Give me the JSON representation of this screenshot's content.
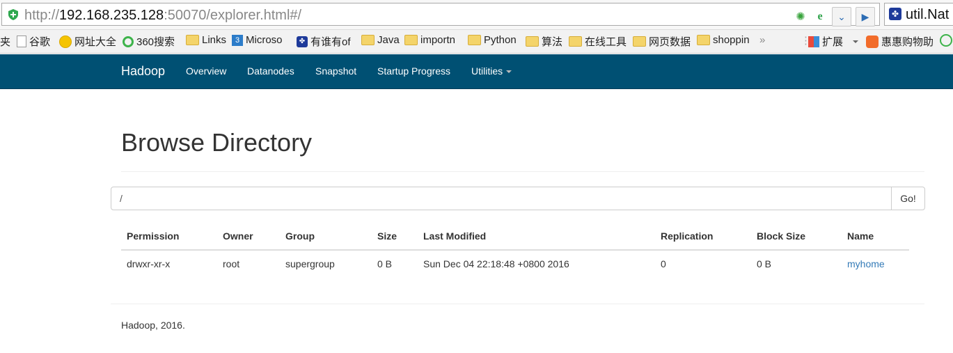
{
  "browser": {
    "url_prefix": "http://",
    "url_host": "192.168.235.128",
    "url_rest": ":50070/explorer.html#/",
    "side_text": "util.Nat",
    "colors": {
      "shield": "#2fa84f"
    }
  },
  "bookmarks": [
    {
      "label": "夹",
      "icon": "none"
    },
    {
      "label": "谷歌",
      "icon": "page-icon"
    },
    {
      "label": "网址大全",
      "icon": "plus-circle-icon"
    },
    {
      "label": "360搜索",
      "icon": "360-icon"
    },
    {
      "label": "Links",
      "icon": "folder-icon"
    },
    {
      "label": "Microso",
      "icon": "app-icon"
    },
    {
      "label": "有谁有of",
      "icon": "paw-icon"
    },
    {
      "label": "Java",
      "icon": "folder-icon"
    },
    {
      "label": "importn",
      "icon": "folder-icon"
    },
    {
      "label": "Python",
      "icon": "folder-icon"
    },
    {
      "label": "算法",
      "icon": "folder-icon"
    },
    {
      "label": "在线工具",
      "icon": "folder-icon"
    },
    {
      "label": "网页数据",
      "icon": "folder-icon"
    },
    {
      "label": "shoppin",
      "icon": "folder-icon"
    },
    {
      "label": "»",
      "icon": "none"
    },
    {
      "label": "扩展",
      "icon": "grid-icon"
    },
    {
      "label": "惠惠购物助",
      "icon": "bag-icon"
    }
  ],
  "navbar": {
    "brand": "Hadoop",
    "links": [
      "Overview",
      "Datanodes",
      "Snapshot",
      "Startup Progress",
      "Utilities"
    ],
    "bg_color": "#005073"
  },
  "page": {
    "title": "Browse Directory",
    "path_value": "/",
    "go_label": "Go!"
  },
  "table": {
    "headers": [
      "Permission",
      "Owner",
      "Group",
      "Size",
      "Last Modified",
      "Replication",
      "Block Size",
      "Name"
    ],
    "rows": [
      [
        "drwxr-xr-x",
        "root",
        "supergroup",
        "0 B",
        "Sun Dec 04 22:18:48 +0800 2016",
        "0",
        "0 B",
        "myhome"
      ]
    ],
    "link_color": "#337ab7"
  },
  "footer": "Hadoop, 2016."
}
